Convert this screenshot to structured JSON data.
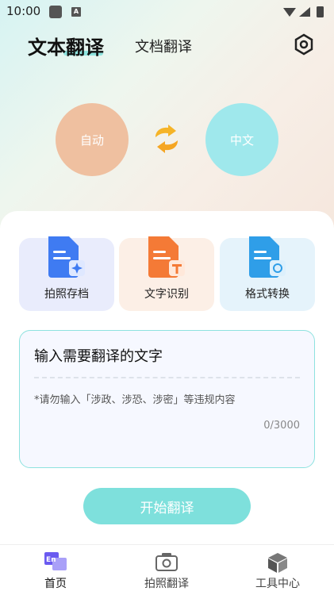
{
  "status_bar": {
    "time": "10:00",
    "notif_letter": "A"
  },
  "header": {
    "tab_text": "文本翻译",
    "tab_doc": "文档翻译"
  },
  "languages": {
    "source": "自动",
    "target": "中文"
  },
  "tools": [
    {
      "label": "拍照存档"
    },
    {
      "label": "文字识别"
    },
    {
      "label": "格式转换"
    }
  ],
  "input": {
    "title": "输入需要翻译的文字",
    "warning": "*请勿输入「涉政、涉恐、涉密」等违规内容",
    "counter": "0/3000"
  },
  "start_button": "开始翻译",
  "nav": [
    {
      "label": "首页"
    },
    {
      "label": "拍照翻译"
    },
    {
      "label": "工具中心"
    }
  ],
  "colors": {
    "accent": "#7ee0dc",
    "source_circle": "#efc0a0",
    "target_circle": "#9fe8ec"
  }
}
